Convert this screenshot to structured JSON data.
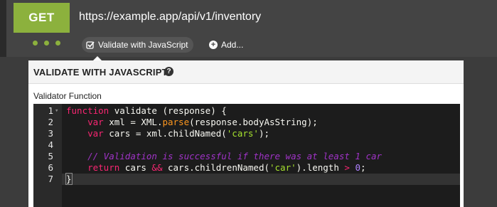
{
  "request": {
    "method": "GET",
    "url": "https://example.app/api/v1/inventory"
  },
  "toolbar": {
    "validate_label": "Validate with JavaScript",
    "add_label": "Add..."
  },
  "panel": {
    "title": "VALIDATE WITH JAVASCRIPT",
    "help_glyph": "?",
    "field_label": "Validator Function"
  },
  "editor": {
    "line_numbers": [
      "1",
      "2",
      "3",
      "4",
      "5",
      "6",
      "7"
    ],
    "active_line": 7
  },
  "colors": {
    "accent": "#8cb13d",
    "background": "#3c3c3c"
  }
}
